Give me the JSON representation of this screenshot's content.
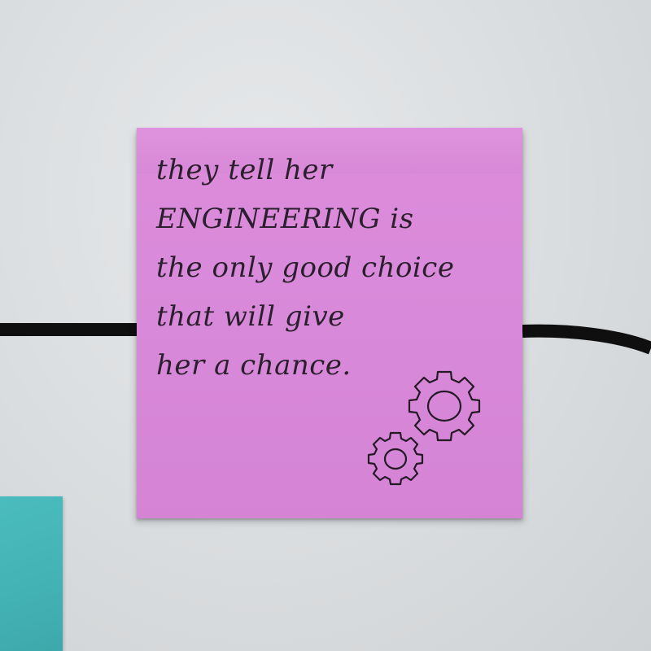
{
  "scene": {
    "background_color": "#dcdfe1",
    "string_color": "#0f0f0f"
  },
  "pink_note": {
    "color": "#d989d9",
    "handwriting": "they tell her\nENGINEERING is\nthe only good choice\nthat will give\nher a chance.",
    "drawing": "gears"
  },
  "teal_note": {
    "color": "#43b2b5"
  }
}
